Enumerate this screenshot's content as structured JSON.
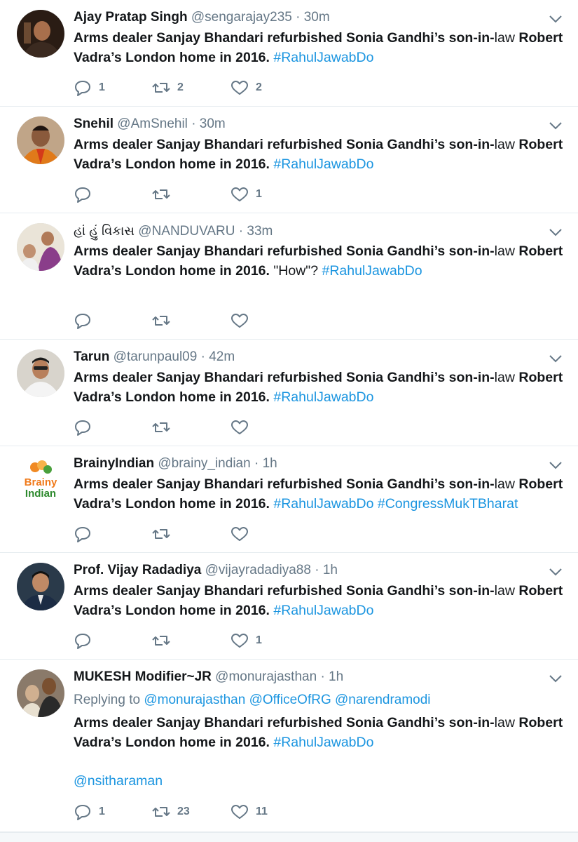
{
  "colors": {
    "link": "#1b95e0",
    "muted": "#657786",
    "text": "#14171a",
    "divider": "#e6ecf0"
  },
  "icons": {
    "reply": "reply-icon",
    "retweet": "retweet-icon",
    "like": "heart-icon",
    "menu": "chevron-down-icon"
  },
  "tweets": [
    {
      "name": "Ajay Pratap Singh",
      "handle": "@sengarajay235",
      "dot": "·",
      "time": "30m",
      "text_bold_1": "Arms dealer Sanjay Bhandari refurbished Sonia Gandhi’s son-in-",
      "text_plain_1": "law ",
      "text_bold_2": "Robert Vadra’s London home in 2016.",
      "text_plain_2": " ",
      "hashtags": "#RahulJawabDo",
      "replies": "1",
      "retweets": "2",
      "likes": "2"
    },
    {
      "name": "Snehil",
      "handle": "@AmSnehil",
      "dot": "·",
      "time": "30m",
      "text_bold_1": "Arms dealer Sanjay Bhandari refurbished Sonia Gandhi’s son-in-",
      "text_plain_1": "law ",
      "text_bold_2": "Robert Vadra’s London home in 2016.",
      "text_plain_2": " ",
      "hashtags": "#RahulJawabDo",
      "replies": "",
      "retweets": "",
      "likes": "1"
    },
    {
      "name": "હાં હું વિકાસ",
      "handle": "@NANDUVARU",
      "dot": "·",
      "time": "33m",
      "text_bold_1": "Arms dealer Sanjay Bhandari refurbished Sonia Gandhi’s son-in-",
      "text_plain_1": "law ",
      "text_bold_2": "Robert Vadra’s London home in 2016.",
      "text_plain_2": " \"How\"? ",
      "hashtags": "#RahulJawabDo",
      "replies": "",
      "retweets": "",
      "likes": ""
    },
    {
      "name": "Tarun",
      "handle": "@tarunpaul09",
      "dot": "·",
      "time": "42m",
      "text_bold_1": "Arms dealer Sanjay Bhandari refurbished Sonia Gandhi’s son-in-",
      "text_plain_1": "law ",
      "text_bold_2": "Robert Vadra’s London home in 2016.",
      "text_plain_2": " ",
      "hashtags": "#RahulJawabDo",
      "replies": "",
      "retweets": "",
      "likes": ""
    },
    {
      "name": "BrainyIndian",
      "handle": "@brainy_indian",
      "dot": "·",
      "time": "1h",
      "avatar_text_1": "Brainy",
      "avatar_text_2": "Indian",
      "text_bold_1": "Arms dealer Sanjay Bhandari refurbished Sonia Gandhi’s son-in-",
      "text_plain_1": "law ",
      "text_bold_2": "Robert Vadra’s London home in 2016.",
      "text_plain_2": " ",
      "hashtags": "#RahulJawabDo #CongressMukTBharat",
      "replies": "",
      "retweets": "",
      "likes": ""
    },
    {
      "name": "Prof. Vijay Radadiya",
      "handle": "@vijayradadiya88",
      "dot": "·",
      "time": "1h",
      "text_bold_1": "Arms dealer Sanjay Bhandari refurbished Sonia Gandhi’s son-in-",
      "text_plain_1": "law ",
      "text_bold_2": "Robert Vadra’s London home in 2016.",
      "text_plain_2": " ",
      "hashtags": "#RahulJawabDo",
      "replies": "",
      "retweets": "",
      "likes": "1"
    },
    {
      "name": "MUKESH Modifier~JR",
      "handle": "@monurajasthan",
      "dot": "·",
      "time": "1h",
      "reply_prefix": "Replying to ",
      "reply_mentions": "@monurajasthan @OfficeOfRG @narendramodi",
      "text_bold_1": "Arms dealer Sanjay Bhandari refurbished Sonia Gandhi’s son-in-",
      "text_plain_1": "law ",
      "text_bold_2": "Robert Vadra’s London home in 2016.",
      "text_plain_2": " ",
      "hashtags": "#RahulJawabDo",
      "extra_mention": "@nsitharaman",
      "replies": "1",
      "retweets": "23",
      "likes": "11"
    }
  ]
}
